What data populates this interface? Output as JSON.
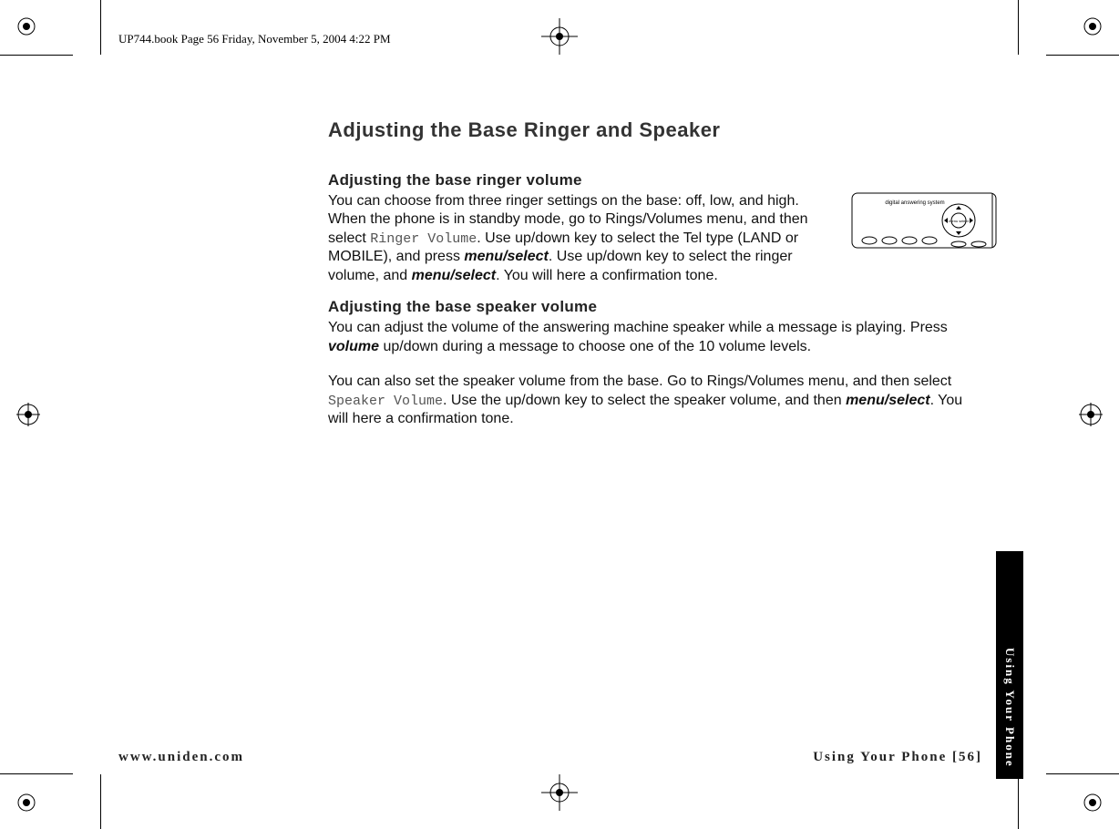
{
  "meta_header": "UP744.book  Page 56  Friday, November 5, 2004  4:22 PM",
  "title": "Adjusting the Base Ringer and Speaker",
  "section1_heading": "Adjusting the base ringer volume",
  "p1a": "You can choose from three ringer settings on the base: off, low, and high. When the phone is in standby mode, go to Rings/Volumes menu, and then select ",
  "p1_mono1": "Ringer Volume",
  "p1b": ". Use up/down key to select the Tel type (LAND or MOBILE), and press ",
  "p1_key1": "menu/select",
  "p1c": ". Use up/down key to select the ringer volume, and ",
  "p1_key2": "menu/select",
  "p1d": ". You will here a confirmation tone.",
  "section2_heading": "Adjusting the base speaker volume",
  "p2a": "You can adjust the volume of the answering machine speaker while a message is playing. Press ",
  "p2_key1": "volume",
  "p2b": " up/down during a message to choose one of the 10 volume levels.",
  "p3a": "You can also set the speaker volume from the base. Go to Rings/Volumes menu, and then select ",
  "p3_mono1": "Speaker Volume",
  "p3b": ". Use the up/down key to select the speaker volume, and then ",
  "p3_key1": "menu/select",
  "p3c": ". You will here a confirmation tone.",
  "footer_left": "www.uniden.com",
  "footer_right": "Using Your Phone [56]",
  "sidetab": "Using Your Phone",
  "device_label": "digital answering system"
}
